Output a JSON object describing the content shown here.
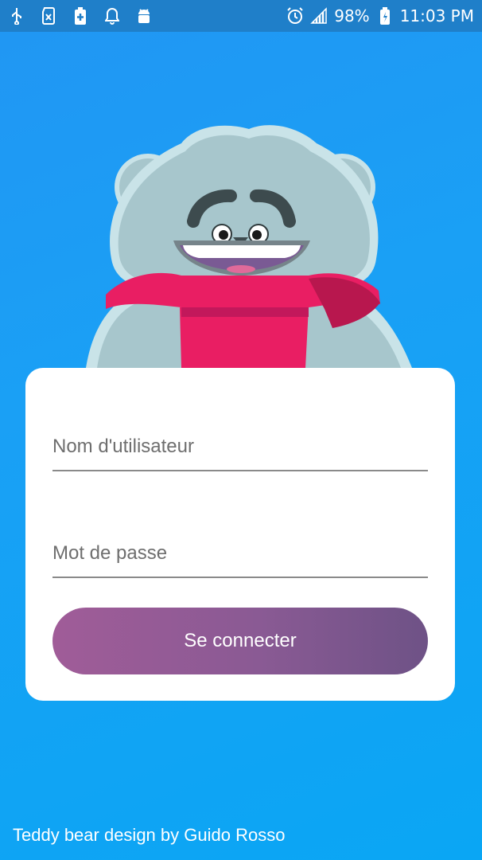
{
  "statusbar": {
    "battery_percent": "98%",
    "time": "11:03 PM",
    "left_icons": [
      "usb-icon",
      "sim-icon",
      "battery-plus-icon",
      "bell-icon",
      "android-debug-icon"
    ],
    "right_icons": [
      "alarm-icon",
      "signal-icon",
      "battery-icon"
    ]
  },
  "login": {
    "username_placeholder": "Nom d'utilisateur",
    "password_placeholder": "Mot de passe",
    "submit_label": "Se connecter"
  },
  "footer": {
    "credit": "Teddy bear design by Guido Rosso"
  },
  "colors": {
    "background": "#1aa0f5",
    "statusbar": "#1f7fc9",
    "button_start": "#a05c98",
    "button_end": "#6e5286",
    "scarf": "#e91e63",
    "bear_fur": "#a7c6cc"
  }
}
